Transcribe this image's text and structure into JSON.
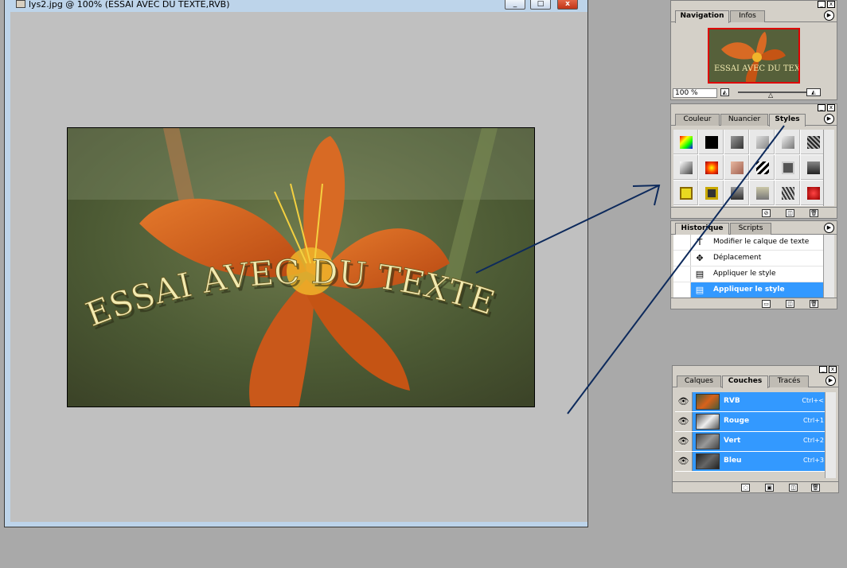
{
  "document": {
    "title": "lys2.jpg @ 100% (ESSAI AVEC DU TEXTE,RVB)",
    "minimize": "_",
    "maximize": "□",
    "close": "x",
    "image_text": "ESSAI AVEC DU TEXTE"
  },
  "navigation": {
    "tabs": [
      "Navigation",
      "Infos"
    ],
    "zoom": "100 %",
    "thumb_text": "ESSAI AVEC DU TEXTE"
  },
  "styles_panel": {
    "tabs": [
      "Couleur",
      "Nuancier",
      "Styles"
    ]
  },
  "historique": {
    "tabs": [
      "Historique",
      "Scripts"
    ],
    "items": [
      {
        "label": "Modifier le calque de texte",
        "icon": "T"
      },
      {
        "label": "Déplacement",
        "icon": "✥"
      },
      {
        "label": "Appliquer le style",
        "icon": "▤"
      },
      {
        "label": "Appliquer le style",
        "icon": "▤"
      }
    ]
  },
  "couches": {
    "tabs": [
      "Calques",
      "Couches",
      "Tracés"
    ],
    "channels": [
      {
        "name": "RVB",
        "key": "Ctrl+<"
      },
      {
        "name": "Rouge",
        "key": "Ctrl+1"
      },
      {
        "name": "Vert",
        "key": "Ctrl+2"
      },
      {
        "name": "Bleu",
        "key": "Ctrl+3"
      }
    ]
  },
  "colors": {
    "selection": "#3399ff",
    "arrow": "#0d2a5c",
    "flower": "#d8621c",
    "text": "#f2eab0"
  }
}
